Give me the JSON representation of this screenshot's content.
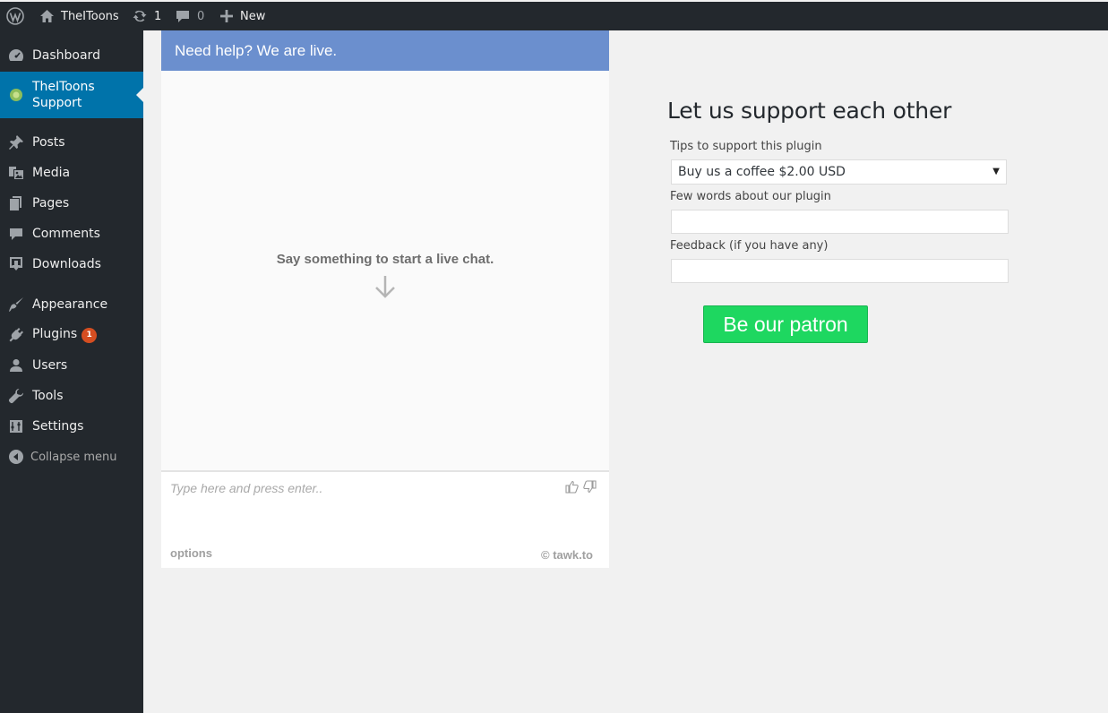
{
  "admin_bar": {
    "wp_logo_icon": "wordpress-logo-icon",
    "site_name": "TheIToons",
    "updates_count": "1",
    "comments_count": "0",
    "new_label": "New"
  },
  "sidebar": {
    "items": [
      {
        "label": "Dashboard",
        "icon": "dashboard-icon"
      },
      {
        "label": "TheIToons Support",
        "icon": "plugin-circle-icon"
      },
      {
        "label": "Posts",
        "icon": "pin-icon"
      },
      {
        "label": "Media",
        "icon": "media-icon"
      },
      {
        "label": "Pages",
        "icon": "pages-icon"
      },
      {
        "label": "Comments",
        "icon": "comment-icon"
      },
      {
        "label": "Downloads",
        "icon": "download-icon"
      },
      {
        "label": "Appearance",
        "icon": "brush-icon"
      },
      {
        "label": "Plugins",
        "icon": "plugin-icon",
        "badge": "1"
      },
      {
        "label": "Users",
        "icon": "user-icon"
      },
      {
        "label": "Tools",
        "icon": "wrench-icon"
      },
      {
        "label": "Settings",
        "icon": "settings-icon"
      },
      {
        "label": "Collapse menu",
        "icon": "collapse-icon"
      }
    ],
    "accent_color": "#0073aa"
  },
  "chat": {
    "header": "Need help? We are live.",
    "hint": "Say something to start a live chat.",
    "input_placeholder": "Type here and press enter..",
    "options_label": "options",
    "brand": "© tawk.to",
    "header_color": "#6b8fce"
  },
  "support": {
    "title": "Let us support each other",
    "tips_label": "Tips to support this plugin",
    "tips_selected": "Buy us a coffee $2.00 USD",
    "words_label": "Few words about our plugin",
    "feedback_label": "Feedback (if you have any)",
    "patron_button": "Be our patron",
    "button_color": "#1ed760"
  }
}
